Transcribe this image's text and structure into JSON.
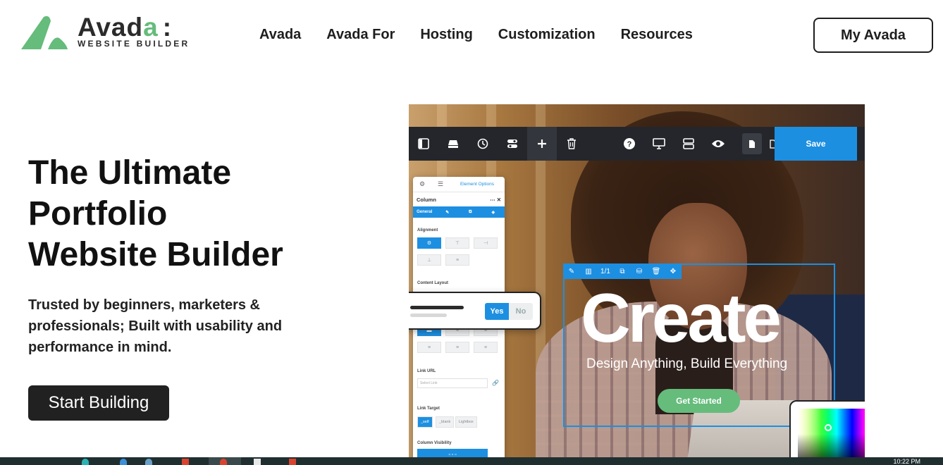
{
  "header": {
    "logo_word_main": "Avad",
    "logo_word_accent": "a",
    "logo_colon": ":",
    "logo_subtitle": "WEBSITE BUILDER",
    "nav": [
      "Avada",
      "Avada For",
      "Hosting",
      "Customization",
      "Resources"
    ],
    "account_button": "My Avada"
  },
  "hero": {
    "title_lines": [
      "The Ultimate",
      "Portfolio",
      "Website Builder"
    ],
    "subtitle": "Trusted by beginners, marketers & professionals; Built with usability and performance in mind.",
    "cta_label": "Start Building"
  },
  "builder": {
    "save_label": "Save",
    "panel": {
      "tab_label": "Element Options",
      "heading": "Column",
      "subtabs": [
        "General",
        "✎",
        "⧉",
        "◈"
      ],
      "alignment_label": "Alignment",
      "content_layout_label": "Content Layout",
      "link_url_label": "Link URL",
      "link_url_placeholder": "Select Link",
      "link_target_label": "Link Target",
      "link_target_options": [
        "_self",
        "_blank",
        "Lightbox"
      ],
      "column_visibility_label": "Column Visibility"
    },
    "toggle": {
      "yes": "Yes",
      "no": "No"
    },
    "element_bar_counter": "1/1",
    "headline": "Create",
    "tagline": "Design Anything, Build Everything",
    "get_started": "Get Started"
  },
  "taskbar": {
    "clock": "10:22 PM"
  },
  "colors": {
    "accent_green": "#65bc7b",
    "builder_blue": "#1d8fe1",
    "dark": "#212121"
  }
}
